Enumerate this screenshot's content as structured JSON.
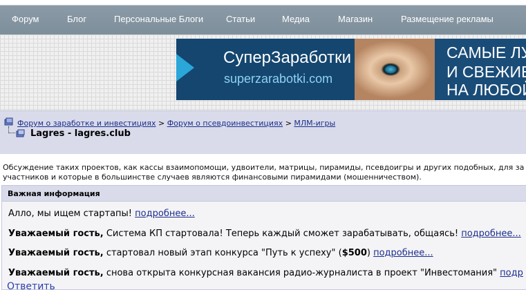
{
  "nav": {
    "items": [
      {
        "label": "Форум"
      },
      {
        "label": "Блог"
      },
      {
        "label": "Персональные Блоги"
      },
      {
        "label": "Статьи"
      },
      {
        "label": "Медиа"
      },
      {
        "label": "Магазин"
      },
      {
        "label": "Размещение рекламы"
      }
    ]
  },
  "banner": {
    "title": "СуперЗаработки",
    "subtitle": "superzarabotki.com",
    "right_lines": [
      "САМЫЕ ЛУ",
      "И СВЕЖИЕ П",
      "НА ЛЮБОЙ"
    ]
  },
  "breadcrumb": {
    "links": [
      "Форум о заработке и инвестициях",
      "Форум о псевдоинвестициях",
      "МЛМ-игры"
    ],
    "separator": ">",
    "topic_title": "Lagres - lagres.club"
  },
  "description": {
    "line1": "Обсуждение таких проектов, как кассы взаимопомощи, удвоители, матрицы, пирамиды, псевдоигры и других подобных, для за",
    "line2": "участников и которые в большинстве случаев являются финансовыми пирамидами (мошенничеством)."
  },
  "info": {
    "header": "Важная информация",
    "more_label": "подробнее...",
    "line1_text": "Алло, мы ищем стартапы!",
    "line2_bold": "Уважаемый гость,",
    "line2_text": "Система КП стартовала! Теперь каждый сможет зарабатывать, общаясь!",
    "line3_bold": "Уважаемый гость,",
    "line3_text_a": "стартовал новый этап конкурса \"Путь к успеху\" (",
    "line3_amount": "$500",
    "line3_text_b": ")",
    "line4_bold": "Уважаемый гость,",
    "line4_text": "снова открыта конкурсная вакансия радио-журналиста в проект \"Инвестомания\"",
    "line4_more": "подр"
  },
  "reply_label": "Ответить"
}
